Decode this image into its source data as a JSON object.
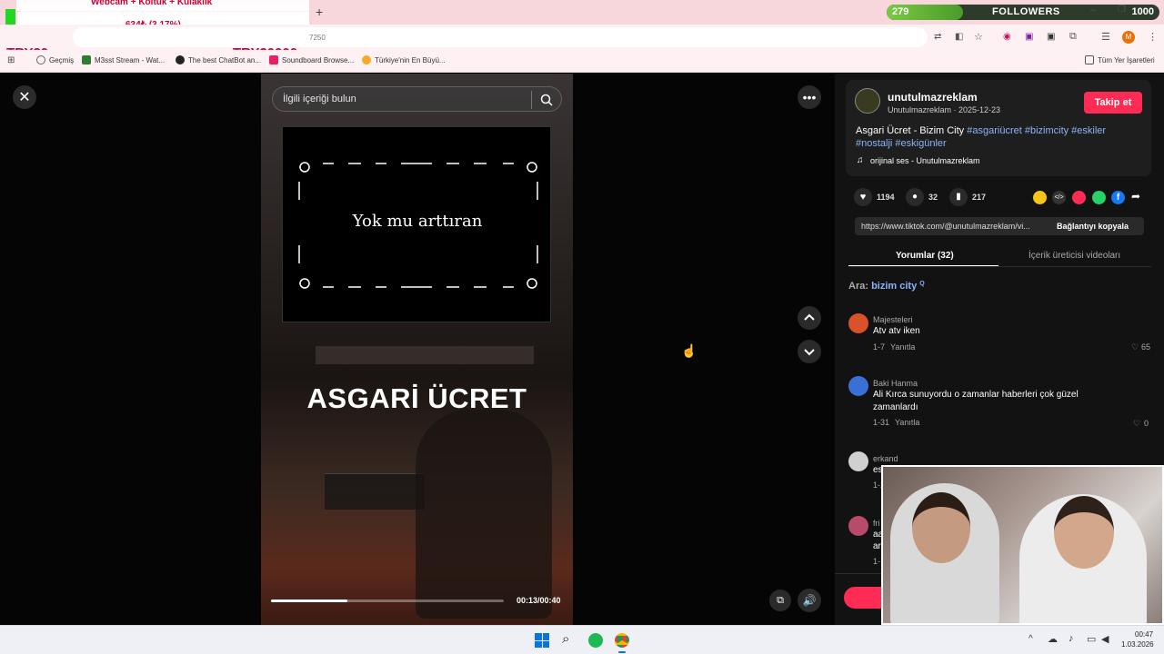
{
  "overlay": {
    "donation_label": "Webcam + Koltuk + Kulaklık",
    "donation_value": "634₺ (3.17%)",
    "try_left": "TRY20",
    "try_right": "TRY20000",
    "donation_progress_fraction": 0.0317,
    "followers_current": "279",
    "followers_label": "FOLLOWERS",
    "followers_goal": "1000"
  },
  "browser": {
    "url_fragment": "7250",
    "bookmarks": [
      {
        "label": "Geçmiş",
        "icon": "history-icon"
      },
      {
        "label": "M3sst Stream - Wat...",
        "icon": "m-icon"
      },
      {
        "label": "The best ChatBot an...",
        "icon": "chatbot-icon"
      },
      {
        "label": "Soundboard Browse...",
        "icon": "soundboard-icon"
      },
      {
        "label": "Türkiye'nin En Büyü...",
        "icon": "site-icon"
      }
    ],
    "all_bookmarks": "Tüm Yer İşaretleri",
    "profile_letter": "M"
  },
  "video": {
    "search_placeholder": "İlgili içeriği bulun",
    "title_card_text": "Yok mu arttıran",
    "caption_big": "ASGARİ ÜCRET",
    "time": "00:13/00:40",
    "progress_fraction": 0.33
  },
  "author": {
    "username": "unutulmazreklam",
    "sub": "Unutulmazreklam · 2025-12-23",
    "follow_button": "Takip et",
    "description": "Asgari Ücret - Bizim City",
    "hashtags": "#asgariücret #bizimcity #eskiler #nostalji #eskigünler",
    "sound": "orijinal ses - Unutulmazreklam"
  },
  "stats": {
    "likes": "1194",
    "comments": "32",
    "saves": "217"
  },
  "link": {
    "url": "https://www.tiktok.com/@unutulmazreklam/vi...",
    "copy_button": "Bağlantıyı kopyala"
  },
  "tabs": {
    "comments": "Yorumlar (32)",
    "creator_videos": "İçerik üreticisi videoları"
  },
  "search_suggestion": {
    "prefix": "Ara:",
    "term": "bizim city"
  },
  "comments": [
    {
      "name": "Majesteleri",
      "text": "Atv atv iken",
      "date": "1-7",
      "reply": "Yanıtla",
      "likes": "65",
      "avatar_color": "#d9522a"
    },
    {
      "name": "Baki Hanma",
      "text": "Ali Kırca sunuyordu o zamanlar haberleri çok güzel zamanlardı",
      "date": "1-31",
      "reply": "Yanıtla",
      "likes": "0",
      "avatar_color": "#3a6fd8"
    },
    {
      "name": "erkand",
      "text": "es",
      "date": "1-2",
      "reply": "",
      "likes": "",
      "avatar_color": "#d0d0d0"
    },
    {
      "name": "fri",
      "text": "aa",
      "text2": "ar",
      "date": "1-",
      "reply": "",
      "likes": "",
      "avatar_color": "#b84a6a"
    }
  ],
  "taskbar": {
    "time": "00:47",
    "date": "1.03.2026"
  },
  "colors": {
    "accent": "#fe2c55",
    "hashtag": "#8ab4f8",
    "followers_green": "#7ac943"
  }
}
